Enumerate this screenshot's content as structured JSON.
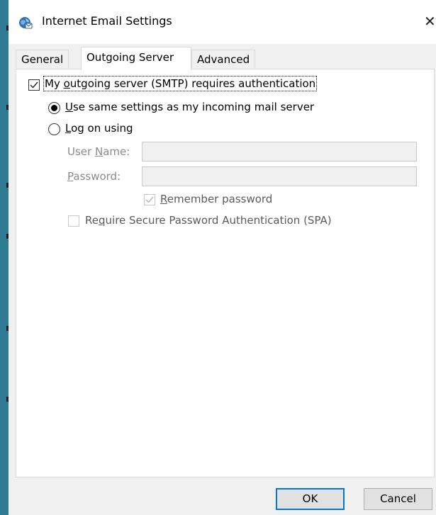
{
  "window": {
    "title": "Internet Email Settings",
    "close_glyph": "✕"
  },
  "tabs": [
    {
      "label": "General"
    },
    {
      "label": "Outgoing Server",
      "active": true
    },
    {
      "label": "Advanced"
    }
  ],
  "outgoing": {
    "requires_auth": {
      "label": "My outgoing server (SMTP) requires authentication",
      "mnemonic": "o",
      "checked": true
    },
    "use_same": {
      "label": "Use same settings as my incoming mail server",
      "mnemonic": "U",
      "selected": true
    },
    "log_on": {
      "label": "Log on using",
      "mnemonic": "L",
      "selected": false
    },
    "user_name": {
      "label": "User Name:",
      "mnemonic": "N",
      "value": ""
    },
    "password": {
      "label": "Password:",
      "mnemonic": "P",
      "value": ""
    },
    "remember_password": {
      "label": "Remember password",
      "mnemonic": "R",
      "checked": true,
      "enabled": false
    },
    "spa": {
      "label": "Require Secure Password Authentication (SPA)",
      "mnemonic": "q",
      "checked": false,
      "enabled": false
    }
  },
  "buttons": {
    "ok": "OK",
    "cancel": "Cancel"
  },
  "colors": {
    "desktop": "#2e7a93",
    "dialog": "#f0f0f0",
    "accent": "#0078d7"
  },
  "icons": {
    "title": "globe-mail-icon",
    "checkmark": "checkmark-icon",
    "close": "close-icon"
  }
}
